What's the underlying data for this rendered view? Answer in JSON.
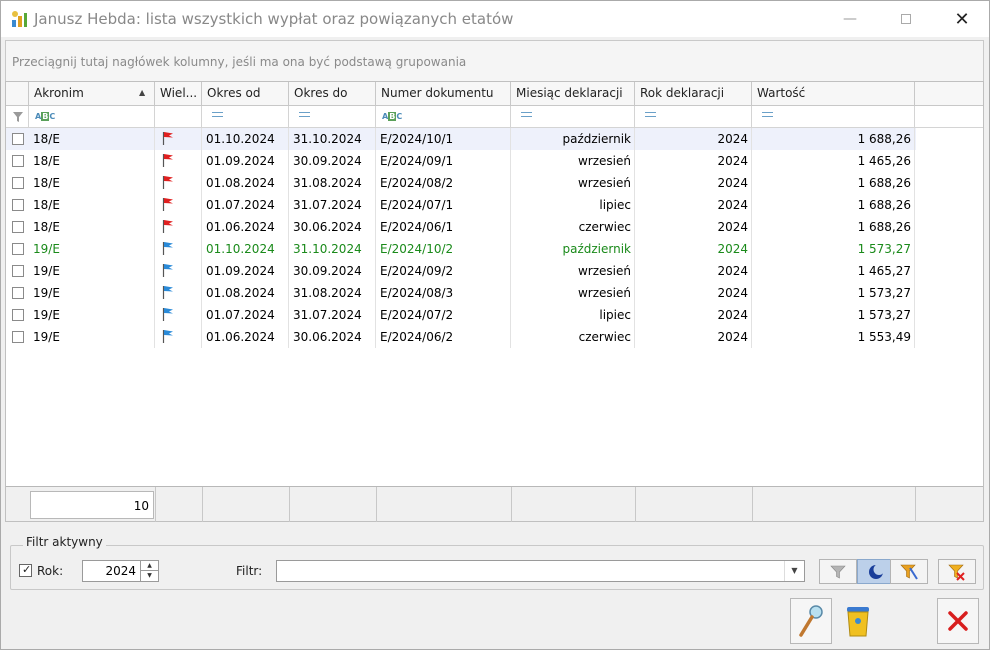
{
  "window": {
    "title": "Janusz Hebda: lista wszystkich wypłat oraz powiązanych etatów",
    "minimize_icon": "minimize-icon",
    "maximize_icon": "maximize-icon",
    "close_icon": "close-icon"
  },
  "grid": {
    "group_hint": "Przeciągnij tutaj nagłówek kolumny, jeśli ma ona być podstawą grupowania",
    "columns": [
      "Akronim",
      "Wiel...",
      "Okres od",
      "Okres do",
      "Numer dokumentu",
      "Miesiąc deklaracji",
      "Rok deklaracji",
      "Wartość"
    ],
    "rows": [
      {
        "akronim": "18/E",
        "flag": "red",
        "od": "01.10.2024",
        "do": "31.10.2024",
        "numer": "E/2024/10/1",
        "miesiac": "październik",
        "rok": "2024",
        "wartosc": "1 688,26",
        "selected": true,
        "green": false
      },
      {
        "akronim": "18/E",
        "flag": "red",
        "od": "01.09.2024",
        "do": "30.09.2024",
        "numer": "E/2024/09/1",
        "miesiac": "wrzesień",
        "rok": "2024",
        "wartosc": "1 465,26",
        "selected": false,
        "green": false
      },
      {
        "akronim": "18/E",
        "flag": "red",
        "od": "01.08.2024",
        "do": "31.08.2024",
        "numer": "E/2024/08/2",
        "miesiac": "wrzesień",
        "rok": "2024",
        "wartosc": "1 688,26",
        "selected": false,
        "green": false
      },
      {
        "akronim": "18/E",
        "flag": "red",
        "od": "01.07.2024",
        "do": "31.07.2024",
        "numer": "E/2024/07/1",
        "miesiac": "lipiec",
        "rok": "2024",
        "wartosc": "1 688,26",
        "selected": false,
        "green": false
      },
      {
        "akronim": "18/E",
        "flag": "red",
        "od": "01.06.2024",
        "do": "30.06.2024",
        "numer": "E/2024/06/1",
        "miesiac": "czerwiec",
        "rok": "2024",
        "wartosc": "1 688,26",
        "selected": false,
        "green": false
      },
      {
        "akronim": "19/E",
        "flag": "blue",
        "od": "01.10.2024",
        "do": "31.10.2024",
        "numer": "E/2024/10/2",
        "miesiac": "październik",
        "rok": "2024",
        "wartosc": "1 573,27",
        "selected": false,
        "green": true
      },
      {
        "akronim": "19/E",
        "flag": "blue",
        "od": "01.09.2024",
        "do": "30.09.2024",
        "numer": "E/2024/09/2",
        "miesiac": "wrzesień",
        "rok": "2024",
        "wartosc": "1 465,27",
        "selected": false,
        "green": false
      },
      {
        "akronim": "19/E",
        "flag": "blue",
        "od": "01.08.2024",
        "do": "31.08.2024",
        "numer": "E/2024/08/3",
        "miesiac": "wrzesień",
        "rok": "2024",
        "wartosc": "1 573,27",
        "selected": false,
        "green": false
      },
      {
        "akronim": "19/E",
        "flag": "blue",
        "od": "01.07.2024",
        "do": "31.07.2024",
        "numer": "E/2024/07/2",
        "miesiac": "lipiec",
        "rok": "2024",
        "wartosc": "1 573,27",
        "selected": false,
        "green": false
      },
      {
        "akronim": "19/E",
        "flag": "blue",
        "od": "01.06.2024",
        "do": "30.06.2024",
        "numer": "E/2024/06/2",
        "miesiac": "czerwiec",
        "rok": "2024",
        "wartosc": "1 553,49",
        "selected": false,
        "green": false
      }
    ],
    "record_count": "10",
    "sort_icon": "sort-ascending-icon"
  },
  "filter": {
    "legend": "Filtr aktywny",
    "rok_label": "Rok:",
    "rok_checked": true,
    "rok_value": "2024",
    "filtr_label": "Filtr:",
    "filtr_value": ""
  },
  "colors": {
    "accent_green": "#1a8a1a",
    "flag_red": "#e02020",
    "flag_blue": "#2a8ad8",
    "close_red": "#d81e1e"
  }
}
